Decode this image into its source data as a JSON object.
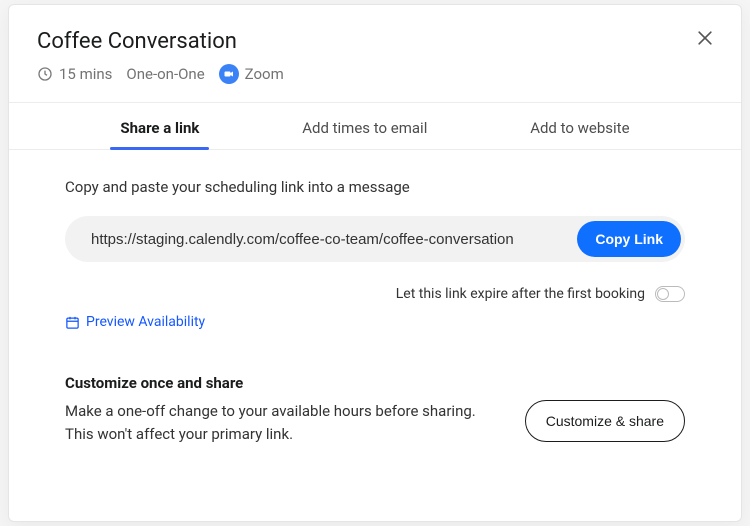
{
  "header": {
    "title": "Coffee Conversation",
    "duration": "15 mins",
    "type": "One-on-One",
    "location": "Zoom"
  },
  "tabs": [
    {
      "label": "Share a link",
      "active": true
    },
    {
      "label": "Add times to email",
      "active": false
    },
    {
      "label": "Add to website",
      "active": false
    }
  ],
  "share": {
    "instruction": "Copy and paste your scheduling link into a message",
    "link_value": "https://staging.calendly.com/coffee-co-team/coffee-conversation",
    "copy_button": "Copy Link",
    "expire_label": "Let this link expire after the first booking",
    "expire_enabled": false,
    "preview_label": "Preview Availability"
  },
  "customize": {
    "heading": "Customize once and share",
    "description": "Make a one-off change to your available hours before sharing. This won't affect your primary link.",
    "button": "Customize & share"
  }
}
